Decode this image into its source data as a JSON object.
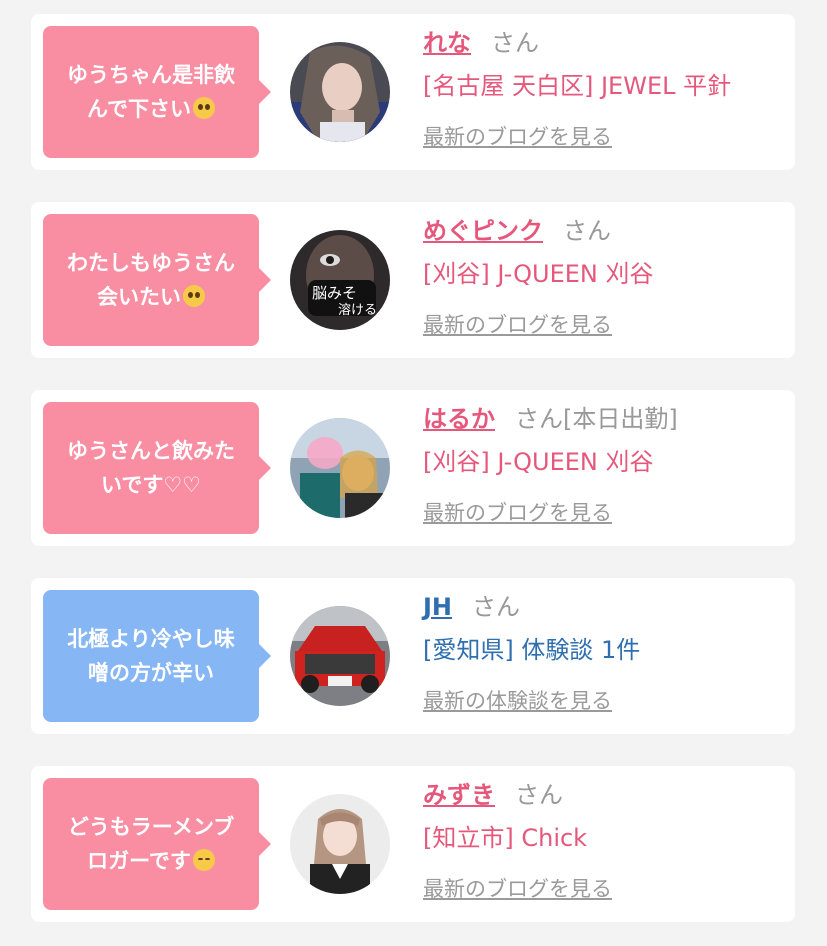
{
  "cards": [
    {
      "message": "ゆうちゃん是非飲\nんで下さい",
      "message_emoji": "pleading-face-icon",
      "name": "れな",
      "honorific": "さん",
      "status": "",
      "detail": "[名古屋 天白区] JEWEL 平針",
      "link": "最新のブログを見る",
      "theme": "pink"
    },
    {
      "message": "わたしもゆうさん\n会いたい",
      "message_emoji": "pleading-face-icon",
      "name": "めぐピンク",
      "honorific": "さん",
      "status": "",
      "detail": "[刈谷] J-QUEEN 刈谷",
      "link": "最新のブログを見る",
      "theme": "pink"
    },
    {
      "message": "ゆうさんと飲みた\nいです♡♡",
      "message_emoji": "",
      "name": "はるか",
      "honorific": "さん",
      "status": "[本日出勤]",
      "detail": "[刈谷] J-QUEEN 刈谷",
      "link": "最新のブログを見る",
      "theme": "pink"
    },
    {
      "message": "北極より冷やし味\n噌の方が辛い",
      "message_emoji": "",
      "name": "JH",
      "honorific": "さん",
      "status": "",
      "detail": "[愛知県] 体験談 1件",
      "link": "最新の体験談を見る",
      "theme": "blue"
    },
    {
      "message": "どうもラーメンブ\nロガーです",
      "message_emoji": "kissing-face-icon",
      "name": "みずき",
      "honorific": "さん",
      "status": "",
      "detail": "[知立市] Chick",
      "link": "最新のブログを見る",
      "theme": "pink"
    }
  ],
  "colors": {
    "pink_bubble": "#f98ea3",
    "blue_bubble": "#86b6f4",
    "pink_text": "#e5587c",
    "blue_text": "#2f6fb0",
    "muted": "#999999"
  }
}
